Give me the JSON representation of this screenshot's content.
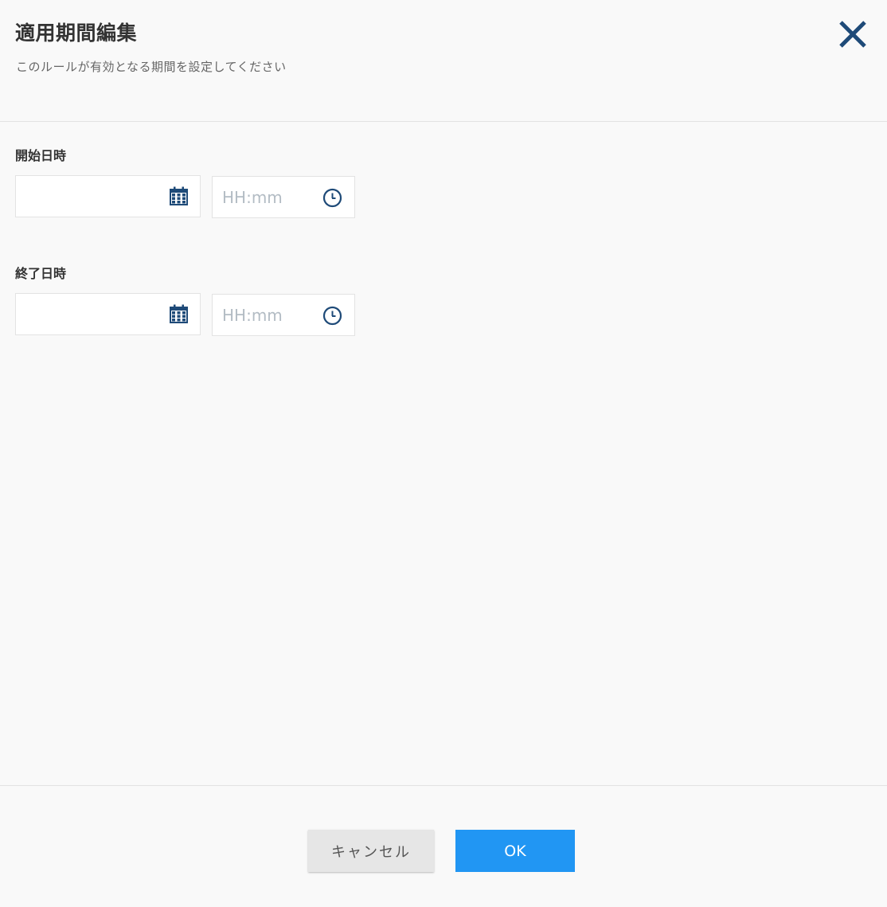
{
  "dialog": {
    "title": "適用期間編集",
    "subtitle": "このルールが有効となる期間を設定してください",
    "close_icon": "close-icon"
  },
  "start": {
    "label": "開始日時",
    "date_value": "",
    "time_value": "",
    "time_placeholder": "HH:mm",
    "date_icon": "calendar-icon",
    "time_icon": "clock-icon"
  },
  "end": {
    "label": "終了日時",
    "date_value": "",
    "time_value": "",
    "time_placeholder": "HH:mm",
    "date_icon": "calendar-icon",
    "time_icon": "clock-icon"
  },
  "footer": {
    "cancel_label": "キャンセル",
    "ok_label": "OK"
  },
  "colors": {
    "primary": "#2196f3",
    "icon": "#1e4a78",
    "cancel_bg": "#e6e6e6"
  }
}
